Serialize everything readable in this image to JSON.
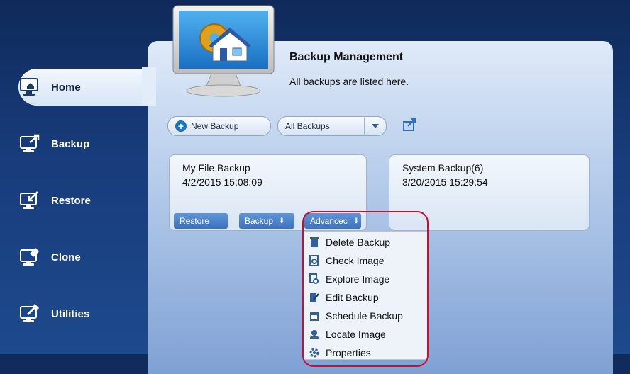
{
  "nav": {
    "items": [
      {
        "label": "Home",
        "icon": "home-monitor-icon"
      },
      {
        "label": "Backup",
        "icon": "backup-monitor-icon"
      },
      {
        "label": "Restore",
        "icon": "restore-monitor-icon"
      },
      {
        "label": "Clone",
        "icon": "clone-monitor-icon"
      },
      {
        "label": "Utilities",
        "icon": "utilities-monitor-icon"
      }
    ],
    "active": "Home"
  },
  "header": {
    "title": "Backup Management",
    "subtitle": "All backups are listed here."
  },
  "toolbar": {
    "new_backup_label": "New Backup",
    "filter_value": "All Backups"
  },
  "cards": [
    {
      "name": "My File Backup",
      "date": "4/2/2015 15:08:09",
      "buttons": {
        "restore": "Restore",
        "backup": "Backup",
        "advanced": "Advancec"
      }
    },
    {
      "name": "System Backup(6)",
      "date": "3/20/2015 15:29:54"
    }
  ],
  "menu": {
    "items": [
      {
        "label": "Delete Backup",
        "icon": "trash-icon"
      },
      {
        "label": "Check Image",
        "icon": "check-image-icon"
      },
      {
        "label": "Explore Image",
        "icon": "explore-image-icon"
      },
      {
        "label": "Edit Backup",
        "icon": "edit-backup-icon"
      },
      {
        "label": "Schedule Backup",
        "icon": "calendar-icon"
      },
      {
        "label": "Locate Image",
        "icon": "locate-icon"
      },
      {
        "label": "Properties",
        "icon": "gear-icon"
      }
    ]
  },
  "colors": {
    "accent": "#1c73c8",
    "highlight": "#c8102e",
    "background": "#183c7c"
  }
}
